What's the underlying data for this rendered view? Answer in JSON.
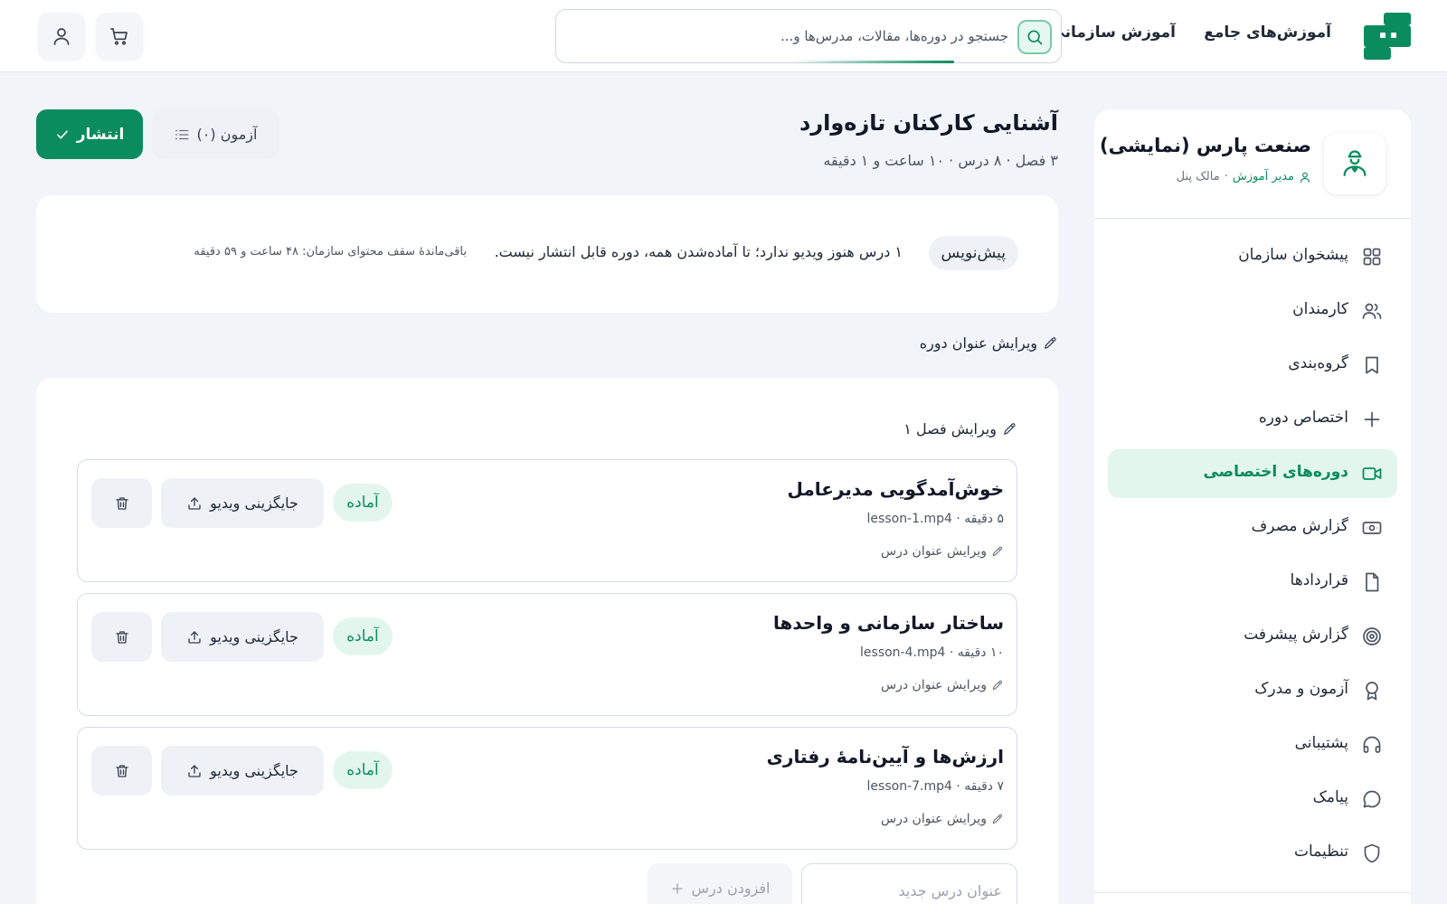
{
  "header": {
    "logo_icon": "brand-logo-icon",
    "nav": [
      {
        "label": "آموزش‌های جامع"
      },
      {
        "label": "آموزش سازمانی"
      }
    ],
    "search": {
      "placeholder": "جستجو در دوره‌ها، مقالات، مدرس‌ها و...",
      "value": "",
      "icon": "search-icon"
    },
    "cart_icon": "cart-icon",
    "user_icon": "user-icon"
  },
  "sidebar": {
    "org_name": "صنعت پارس (نمایشی)",
    "org_role": "مدیر آموزش",
    "org_owner": "مالک پنل",
    "meta_separator": "·",
    "avatar_icon": "employee-avatar-icon",
    "items": [
      {
        "label": "پیشخوان سازمان",
        "icon": "grid-icon"
      },
      {
        "label": "کارمندان",
        "icon": "users-icon"
      },
      {
        "label": "گروه‌بندی",
        "icon": "bookmark-icon"
      },
      {
        "label": "اختصاص دوره",
        "icon": "plus-icon"
      },
      {
        "label": "دوره‌های اختصاصی",
        "icon": "video-icon",
        "active": true
      },
      {
        "label": "گزارش مصرف",
        "icon": "banknote-icon"
      },
      {
        "label": "قراردادها",
        "icon": "file-icon"
      },
      {
        "label": "گزارش پیشرفت",
        "icon": "target-icon"
      },
      {
        "label": "آزمون و مدرک",
        "icon": "award-icon"
      },
      {
        "label": "پشتیبانی",
        "icon": "headphones-icon"
      },
      {
        "label": "پیامک",
        "icon": "message-icon"
      },
      {
        "label": "تنظیمات",
        "icon": "shield-icon"
      }
    ]
  },
  "course": {
    "title": "آشنایی کارکنان تازه‌وارد",
    "meta": "۳ فصل · ۸ درس · ۱۰ ساعت و ۱ دقیقه",
    "publish_label": "انتشار",
    "quiz_label": "آزمون (۰)",
    "edit_title_label": "ویرایش عنوان دوره"
  },
  "status": {
    "badge": "پیش‌نویس",
    "message": "۱ درس هنوز ویدیو ندارد؛ تا آماده‌شدن همه، دوره قابل انتشار نیست.",
    "quota": "باقی‌ماندهٔ سقف محتوای سازمان: ۴۸ ساعت و ۵۹ دقیقه"
  },
  "chapter": {
    "edit_label": "ویرایش فصل ۱",
    "lessons": [
      {
        "title": "خوش‌آمدگویی مدیرعامل",
        "duration": "۵ دقیقه",
        "file": "lesson-1.mp4",
        "status": "آماده"
      },
      {
        "title": "ساختار سازمانی و واحدها",
        "duration": "۱۰ دقیقه",
        "file": "lesson-4.mp4",
        "status": "آماده"
      },
      {
        "title": "ارزش‌ها و آیین‌نامهٔ رفتاری",
        "duration": "۷ دقیقه",
        "file": "lesson-7.mp4",
        "status": "آماده"
      }
    ],
    "edit_lesson_label": "ویرایش عنوان درس",
    "replace_video_label": "جایگزینی ویدیو",
    "new_lesson_placeholder": "عنوان درس جدید",
    "add_lesson_label": "افزودن درس"
  },
  "colors": {
    "brand": "#0a8c5e",
    "brand_light": "#e3f6ee",
    "background": "#f1f4f9"
  }
}
